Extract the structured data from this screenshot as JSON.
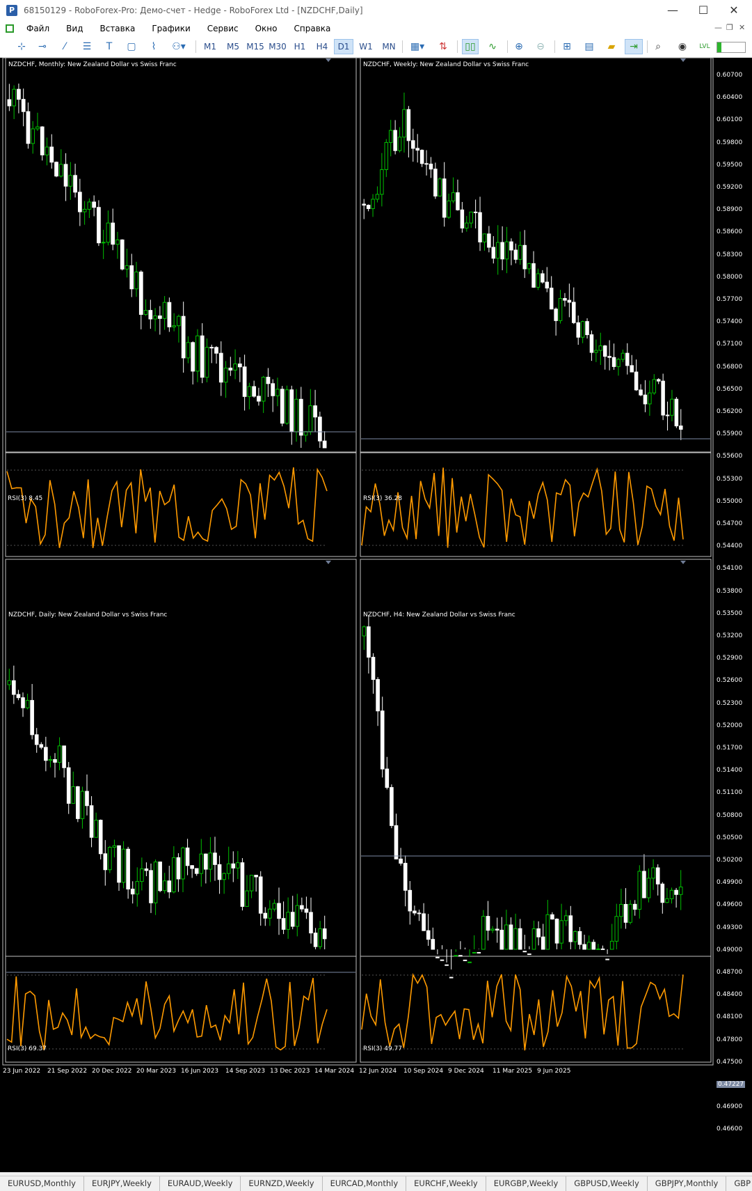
{
  "window": {
    "title": "68150129 - RoboForex-Pro: Демо-счет - Hedge - RoboForex Ltd - [NZDCHF,Daily]",
    "app_icon": "P",
    "minimize": "—",
    "maximize": "☐",
    "close": "✕"
  },
  "menu": {
    "items": [
      "Файл",
      "Вид",
      "Вставка",
      "Графики",
      "Сервис",
      "Окно",
      "Справка"
    ],
    "right": [
      "—",
      "❐",
      "✕"
    ]
  },
  "toolbar": {
    "timeframes": [
      "M1",
      "M5",
      "M15",
      "M30",
      "H1",
      "H4",
      "D1",
      "W1",
      "MN"
    ],
    "active_timeframe": "D1",
    "icons": [
      "crosshair-icon",
      "hline-icon",
      "trendline-icon",
      "channel-icon",
      "text-icon",
      "rectangle-icon",
      "indicator-icon",
      "shapes-icon",
      "chart-type-icon",
      "trade-icon",
      "candles-icon",
      "line-icon",
      "zoom-in-icon",
      "zoom-out-icon",
      "tile-icon",
      "data-window-icon",
      "folder-icon",
      "autoscroll-icon",
      "search-icon",
      "account-icon",
      "level-icon"
    ]
  },
  "charts": [
    {
      "label": "NZDCHF, Monthly:  New Zealand Dollar vs Swiss Franc",
      "rsi_label": "RSI(3) 8.45"
    },
    {
      "label": "NZDCHF, Weekly:  New Zealand Dollar vs Swiss Franc",
      "rsi_label": "RSI(3) 36.28"
    },
    {
      "label": "NZDCHF, Daily:  New Zealand Dollar vs Swiss Franc",
      "rsi_label": "RSI(3) 69.37"
    },
    {
      "label": "NZDCHF, H4:  New Zealand Dollar vs Swiss Franc",
      "rsi_label": "RSI(3) 49.77"
    }
  ],
  "price_axis": [
    "0.60700",
    "0.60400",
    "0.60100",
    "0.59800",
    "0.59500",
    "0.59200",
    "0.58900",
    "0.58600",
    "0.58300",
    "0.58000",
    "0.57700",
    "0.57400",
    "0.57100",
    "0.56800",
    "0.56500",
    "0.56200",
    "0.55900",
    "0.55600",
    "0.55300",
    "0.55000",
    "0.54700",
    "0.54400",
    "0.54100",
    "0.53800",
    "0.53500",
    "0.53200",
    "0.52900",
    "0.52600",
    "0.52300",
    "0.52000",
    "0.51700",
    "0.51400",
    "0.51100",
    "0.50800",
    "0.50500",
    "0.50200",
    "0.49900",
    "0.49600",
    "0.49300",
    "0.49000",
    "0.48700",
    "0.48400",
    "0.48100",
    "0.47800",
    "0.47500",
    "0.47227",
    "0.46900",
    "0.46600"
  ],
  "highlighted_price": "0.47227",
  "time_axis": [
    "23 Jun 2022",
    "21 Sep 2022",
    "20 Dec 2022",
    "20 Mar 2023",
    "16 Jun 2023",
    "14 Sep 2023",
    "13 Dec 2023",
    "14 Mar 2024",
    "12 Jun 2024",
    "10 Sep 2024",
    "9 Dec 2024",
    "11 Mar 2025",
    "9 Jun 2025"
  ],
  "tabs": [
    "EURUSD,Monthly",
    "EURJPY,Weekly",
    "EURAUD,Weekly",
    "EURNZD,Weekly",
    "EURCAD,Monthly",
    "EURCHF,Weekly",
    "EURGBP,Weekly",
    "GBPUSD,Weekly",
    "GBPJPY,Monthly",
    "GBP"
  ],
  "colors": {
    "bull": "#00c000",
    "bear": "#ffffff",
    "rsi": "#ff9a00",
    "bid_line": "#7d8aa3",
    "grid": "#444444"
  }
}
